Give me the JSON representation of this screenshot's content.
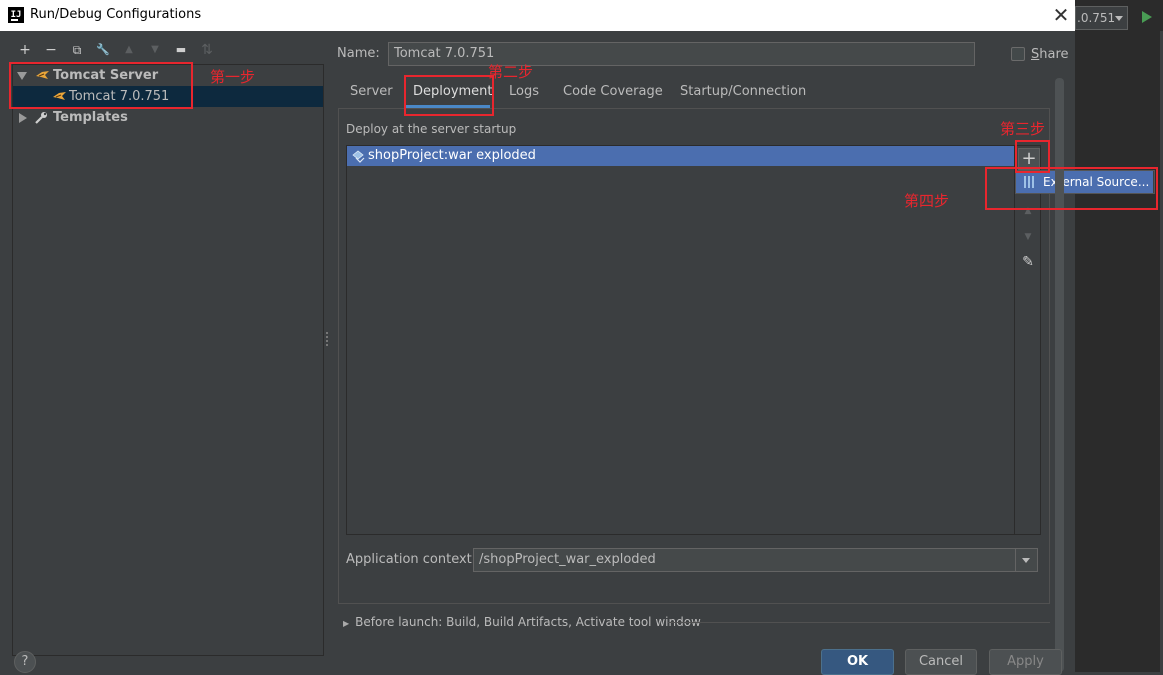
{
  "window": {
    "title": "Run/Debug Configurations",
    "logo": "IJ",
    "close_icon": "✕"
  },
  "ide_background": {
    "run_config_text": ".0.751"
  },
  "toolbar": {
    "add": "+",
    "remove": "−",
    "copy": "⧉",
    "edit_defaults": "🔧",
    "move_up": "▲",
    "move_down": "▼",
    "new_folder": "▬",
    "sort": "⇅"
  },
  "tree": {
    "items": [
      {
        "label": "Tomcat Server",
        "bold": true,
        "expanded": true
      },
      {
        "label": "Tomcat 7.0.751",
        "bold": false,
        "selected": true
      },
      {
        "label": "Templates",
        "bold": true,
        "expanded": false
      }
    ]
  },
  "config": {
    "name_label": "Name:",
    "name_value": "Tomcat 7.0.751",
    "share_checked": false,
    "share_label_first": "S",
    "share_label_rest": "hare"
  },
  "tabs": {
    "items": [
      "Server",
      "Deployment",
      "Logs",
      "Code Coverage",
      "Startup/Connection"
    ],
    "active": "Deployment"
  },
  "deployment": {
    "section_label": "Deploy at the server startup",
    "artifacts": [
      "shopProject:war exploded"
    ],
    "buttons": {
      "add": "+",
      "remove": "−",
      "up": "▲",
      "down": "▼",
      "edit": "✎"
    },
    "popup_item": "External Source...",
    "context_label": "Application context:",
    "context_value": "/shopProject_war_exploded"
  },
  "before_launch": {
    "text": "Before launch: Build, Build Artifacts, Activate tool window",
    "arrow": "▶"
  },
  "footer": {
    "help": "?",
    "ok": "OK",
    "cancel": "Cancel",
    "apply": "Apply"
  },
  "annotations": {
    "step1": "第一步",
    "step2": "第二步",
    "step3": "第三步",
    "step4": "第四步",
    "color": "#e8262e"
  }
}
